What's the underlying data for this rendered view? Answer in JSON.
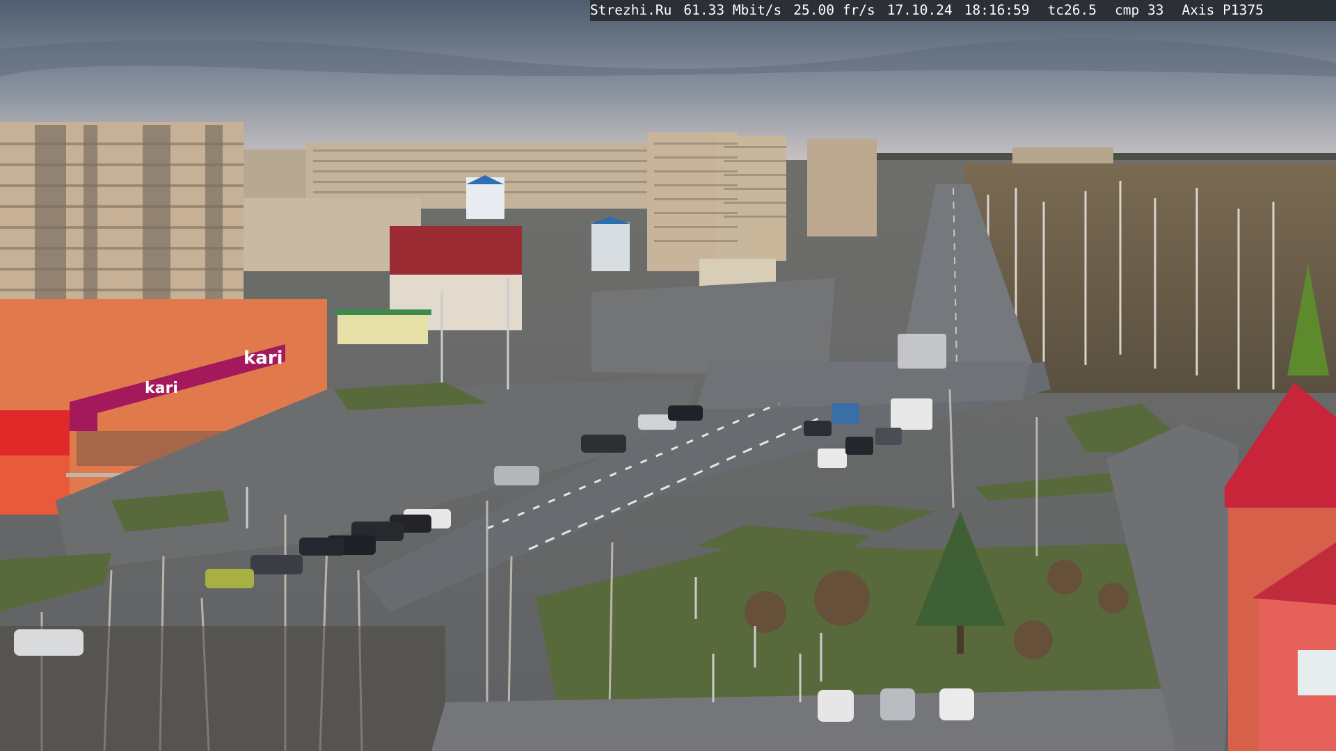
{
  "camera_overlay": {
    "site": "Strezhi.Ru",
    "bitrate": "61.33 Mbit/s",
    "framerate": "25.00 fr/s",
    "date": "17.10.24",
    "time": "18:16:59",
    "tc": "tc26.5",
    "cmp": "cmp 33",
    "camera_model": "Axis P1375"
  },
  "signs": {
    "store_sign": "kari",
    "store_subsign": "kari"
  },
  "colors": {
    "sky_top": "#55657a",
    "sky_horizon": "#c4bfc0",
    "overlay_bg": "#2b2f36",
    "overlay_text": "#ffffff",
    "road": "#6a6f75",
    "grass": "#5a6c3e",
    "store_wall": "#e0774c",
    "store_banner": "#a3195b"
  }
}
